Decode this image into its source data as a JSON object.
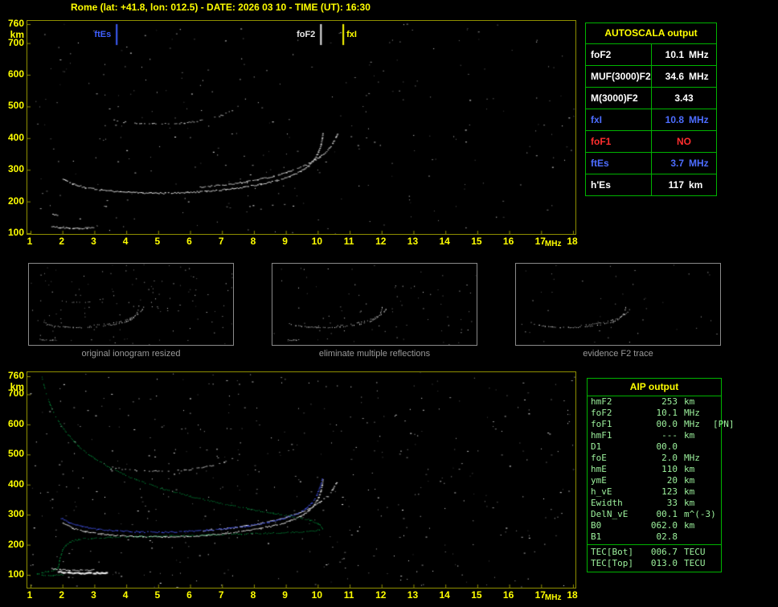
{
  "title": "Rome (lat: +41.8, lon: 012.5) - DATE: 2026 03 10 - TIME (UT): 16:30",
  "colors": {
    "background": "#000000",
    "axis_text": "#ffff00",
    "plot_frame": "#8f8f00",
    "table_border": "#00b400",
    "aip_text": "#9df29d",
    "blue": "#4d6dff",
    "red": "#ff2e2e",
    "white": "#ffffff",
    "profile_green": "#00c050",
    "caption_gray": "#9a9a9a"
  },
  "axes": {
    "x_ticks": [
      1,
      2,
      3,
      4,
      5,
      6,
      7,
      8,
      9,
      10,
      11,
      12,
      13,
      14,
      15,
      16,
      17,
      18
    ],
    "y_ticks": [
      760,
      700,
      600,
      500,
      400,
      300,
      200,
      100
    ],
    "x_unit": "MHz",
    "y_unit": "km"
  },
  "autoscala": {
    "title": "AUTOSCALA output",
    "rows": [
      {
        "label": "foF2",
        "value": "10.1",
        "unit": "MHz",
        "color": "#ffffff"
      },
      {
        "label": "MUF(3000)F2",
        "value": "34.6",
        "unit": "MHz",
        "color": "#ffffff"
      },
      {
        "label": "M(3000)F2",
        "value": "3.43",
        "unit": "",
        "color": "#ffffff"
      },
      {
        "label": "fxI",
        "value": "10.8",
        "unit": "MHz",
        "color": "#4d6dff"
      },
      {
        "label": "foF1",
        "value": "NO",
        "unit": "",
        "color": "#ff2e2e"
      },
      {
        "label": "ftEs",
        "value": "3.7",
        "unit": "MHz",
        "color": "#4d6dff"
      },
      {
        "label": "h'Es",
        "value": "117",
        "unit": "km",
        "color": "#ffffff"
      }
    ]
  },
  "aip": {
    "title": "AIP output",
    "rows": [
      {
        "label": "hmF2",
        "value": "253",
        "unit": "km",
        "extra": ""
      },
      {
        "label": "foF2",
        "value": "10.1",
        "unit": "MHz",
        "extra": ""
      },
      {
        "label": "foF1",
        "value": "00.0",
        "unit": "MHz",
        "extra": "[PN]"
      },
      {
        "label": "hmF1",
        "value": "---",
        "unit": "km",
        "extra": ""
      },
      {
        "label": "D1",
        "value": "00.0",
        "unit": "",
        "extra": ""
      },
      {
        "label": "foE",
        "value": "2.0",
        "unit": "MHz",
        "extra": ""
      },
      {
        "label": "hmE",
        "value": "110",
        "unit": "km",
        "extra": ""
      },
      {
        "label": "ymE",
        "value": "20",
        "unit": "km",
        "extra": ""
      },
      {
        "label": "h_vE",
        "value": "123",
        "unit": "km",
        "extra": ""
      },
      {
        "label": "Ewidth",
        "value": "33",
        "unit": "km",
        "extra": ""
      },
      {
        "label": "DelN_vE",
        "value": "00.1",
        "unit": "m^(-3)",
        "extra": ""
      },
      {
        "label": "B0",
        "value": "062.0",
        "unit": "km",
        "extra": ""
      },
      {
        "label": "B1",
        "value": "02.8",
        "unit": "",
        "extra": ""
      }
    ],
    "tec_rows": [
      {
        "label": "TEC[Bot]",
        "value": "006.7",
        "unit": "TECU",
        "extra": ""
      },
      {
        "label": "TEC[Top]",
        "value": "013.0",
        "unit": "TECU",
        "extra": ""
      }
    ]
  },
  "thumbnails": [
    {
      "caption": "original ionogram resized",
      "series": [
        0,
        1,
        2,
        3,
        4
      ],
      "noise": 120
    },
    {
      "caption": "eliminate multiple reflections",
      "series": [
        0,
        2,
        3
      ],
      "noise": 80
    },
    {
      "caption": "evidence F2 trace",
      "series": [
        2,
        3
      ],
      "noise": 45
    }
  ],
  "chart_data": [
    {
      "type": "scatter",
      "title": "ionogram with autoscaled characteristics",
      "xlabel": "MHz",
      "ylabel": "km",
      "xlim": [
        1,
        18
      ],
      "ylim": [
        100,
        760
      ],
      "noise_dots": 300,
      "markers": [
        {
          "label": "ftEs",
          "x": 3.7,
          "color": "#3f5fff",
          "side": "left"
        },
        {
          "label": "foF2",
          "x": 10.1,
          "color": "#e8e8e8",
          "side": "left"
        },
        {
          "label": "fxI",
          "x": 10.8,
          "color": "#ffff00",
          "side": "right"
        }
      ],
      "series": [
        {
          "name": "Es layer trace",
          "color": "#ffffff",
          "dot": 2,
          "density": 0.9,
          "points": [
            [
              1.65,
              122
            ],
            [
              1.9,
              119
            ],
            [
              2.2,
              117
            ],
            [
              2.5,
              116
            ],
            [
              2.75,
              117
            ],
            [
              2.95,
              118
            ]
          ]
        },
        {
          "name": "Es spot",
          "color": "#ffffff",
          "dot": 2,
          "density": 0.8,
          "points": [
            [
              1.68,
              162
            ],
            [
              1.82,
              158
            ]
          ]
        },
        {
          "name": "F2 trace O-mode",
          "color": "#ffffff",
          "dot": 2,
          "density": 0.92,
          "points": [
            [
              2.0,
              272
            ],
            [
              2.3,
              256
            ],
            [
              2.7,
              245
            ],
            [
              3.2,
              237
            ],
            [
              3.8,
              231
            ],
            [
              4.5,
              228
            ],
            [
              5.2,
              227
            ],
            [
              5.9,
              229
            ],
            [
              6.5,
              233
            ],
            [
              7.1,
              239
            ],
            [
              7.7,
              247
            ],
            [
              8.2,
              256
            ],
            [
              8.7,
              267
            ],
            [
              9.1,
              280
            ],
            [
              9.45,
              296
            ],
            [
              9.7,
              314
            ],
            [
              9.88,
              334
            ],
            [
              10.0,
              356
            ],
            [
              10.08,
              380
            ],
            [
              10.12,
              400
            ],
            [
              10.14,
              415
            ]
          ]
        },
        {
          "name": "F2 trace X-mode",
          "color": "#f0f0f0",
          "dot": 2,
          "density": 0.8,
          "points": [
            [
              6.3,
              246
            ],
            [
              7.0,
              253
            ],
            [
              7.6,
              261
            ],
            [
              8.1,
              270
            ],
            [
              8.6,
              281
            ],
            [
              9.0,
              293
            ],
            [
              9.4,
              307
            ],
            [
              9.75,
              323
            ],
            [
              10.05,
              342
            ],
            [
              10.3,
              363
            ],
            [
              10.45,
              385
            ],
            [
              10.55,
              403
            ],
            [
              10.6,
              415
            ]
          ]
        },
        {
          "name": "multiple reflection trace",
          "color": "#c8c8c8",
          "dot": 2,
          "density": 0.5,
          "points": [
            [
              3.55,
              458
            ],
            [
              3.9,
              452
            ],
            [
              4.3,
              448
            ],
            [
              4.8,
              446
            ],
            [
              5.3,
              446
            ],
            [
              5.8,
              449
            ],
            [
              6.3,
              456
            ],
            [
              6.7,
              465
            ],
            [
              7.05,
              476
            ],
            [
              7.3,
              488
            ]
          ]
        }
      ]
    },
    {
      "type": "scatter",
      "title": "ionogram with modeled trace and electron density profile",
      "xlabel": "MHz",
      "ylabel": "km",
      "xlim": [
        1,
        18
      ],
      "ylim": [
        100,
        760
      ],
      "noise_dots": 480,
      "markers": [],
      "series": [
        {
          "name": "Es layer trace",
          "color": "#ffffff",
          "dot": 2,
          "density": 0.9,
          "points": [
            [
              1.65,
              122
            ],
            [
              1.9,
              119
            ],
            [
              2.2,
              117
            ],
            [
              2.5,
              116
            ],
            [
              2.75,
              117
            ],
            [
              2.95,
              118
            ]
          ]
        },
        {
          "name": "Es strong echo",
          "color": "#ffffff",
          "dot": 3,
          "density": 0.95,
          "points": [
            [
              1.85,
              112
            ],
            [
              2.2,
              109
            ],
            [
              2.6,
              108
            ],
            [
              3.0,
              108
            ],
            [
              3.35,
              110
            ]
          ]
        },
        {
          "name": "F2 trace O-mode",
          "color": "#ffffff",
          "dot": 2,
          "density": 0.92,
          "points": [
            [
              2.0,
              272
            ],
            [
              2.3,
              256
            ],
            [
              2.7,
              245
            ],
            [
              3.2,
              237
            ],
            [
              3.8,
              231
            ],
            [
              4.5,
              228
            ],
            [
              5.2,
              227
            ],
            [
              5.9,
              229
            ],
            [
              6.5,
              233
            ],
            [
              7.1,
              239
            ],
            [
              7.7,
              247
            ],
            [
              8.2,
              256
            ],
            [
              8.7,
              267
            ],
            [
              9.1,
              280
            ],
            [
              9.45,
              296
            ],
            [
              9.7,
              314
            ],
            [
              9.88,
              334
            ],
            [
              10.0,
              356
            ],
            [
              10.08,
              380
            ],
            [
              10.12,
              400
            ],
            [
              10.14,
              415
            ]
          ]
        },
        {
          "name": "F2 trace X-mode",
          "color": "#f0f0f0",
          "dot": 2,
          "density": 0.8,
          "points": [
            [
              6.3,
              246
            ],
            [
              7.0,
              253
            ],
            [
              7.6,
              261
            ],
            [
              8.1,
              270
            ],
            [
              8.6,
              281
            ],
            [
              9.0,
              293
            ],
            [
              9.4,
              307
            ],
            [
              9.75,
              323
            ],
            [
              10.05,
              342
            ],
            [
              10.3,
              363
            ],
            [
              10.45,
              385
            ],
            [
              10.55,
              403
            ],
            [
              10.6,
              415
            ]
          ]
        },
        {
          "name": "multiple reflection trace",
          "color": "#c8c8c8",
          "dot": 2,
          "density": 0.4,
          "points": [
            [
              3.55,
              458
            ],
            [
              3.9,
              452
            ],
            [
              4.3,
              448
            ],
            [
              4.8,
              446
            ],
            [
              5.3,
              446
            ],
            [
              5.8,
              449
            ],
            [
              6.3,
              456
            ],
            [
              6.7,
              465
            ],
            [
              7.05,
              476
            ],
            [
              7.3,
              488
            ]
          ]
        },
        {
          "name": "modeled F2 trace",
          "color": "#4455ee",
          "dot": 2,
          "density": 0.95,
          "points": [
            [
              1.9,
              292
            ],
            [
              2.2,
              274
            ],
            [
              2.6,
              261
            ],
            [
              3.1,
              252
            ],
            [
              3.7,
              247
            ],
            [
              4.4,
              244
            ],
            [
              5.1,
              243
            ],
            [
              5.8,
              245
            ],
            [
              6.5,
              249
            ],
            [
              7.2,
              256
            ],
            [
              7.8,
              264
            ],
            [
              8.4,
              275
            ],
            [
              8.9,
              288
            ],
            [
              9.3,
              303
            ],
            [
              9.6,
              320
            ],
            [
              9.8,
              341
            ],
            [
              9.95,
              365
            ],
            [
              10.05,
              392
            ],
            [
              10.12,
              420
            ]
          ]
        },
        {
          "name": "electron density profile",
          "color": "#00c050",
          "dot": 1,
          "density": 0.85,
          "points": [
            [
              1.35,
              758
            ],
            [
              1.45,
              715
            ],
            [
              1.6,
              668
            ],
            [
              1.8,
              622
            ],
            [
              2.1,
              575
            ],
            [
              2.5,
              528
            ],
            [
              3.0,
              487
            ],
            [
              3.6,
              450
            ],
            [
              4.3,
              417
            ],
            [
              5.1,
              388
            ],
            [
              6.0,
              362
            ],
            [
              6.9,
              340
            ],
            [
              7.8,
              321
            ],
            [
              8.6,
              306
            ],
            [
              9.3,
              293
            ],
            [
              9.75,
              283
            ],
            [
              10.0,
              272
            ],
            [
              10.1,
              262
            ],
            [
              10.14,
              253
            ],
            [
              9.9,
              247
            ],
            [
              9.4,
              243
            ],
            [
              8.6,
              240
            ],
            [
              7.6,
              237
            ],
            [
              6.5,
              234
            ],
            [
              5.4,
              231
            ],
            [
              4.4,
              228
            ],
            [
              3.5,
              226
            ],
            [
              2.9,
              223
            ],
            [
              2.5,
              219
            ],
            [
              2.25,
              212
            ],
            [
              2.1,
              200
            ],
            [
              2.0,
              185
            ],
            [
              1.95,
              168
            ],
            [
              1.9,
              150
            ],
            [
              1.88,
              135
            ],
            [
              1.85,
              124
            ],
            [
              1.75,
              117
            ],
            [
              1.55,
              112
            ],
            [
              1.35,
              108
            ],
            [
              1.2,
              104
            ],
            [
              1.35,
              101
            ],
            [
              1.7,
              100
            ],
            [
              2.0,
              101
            ]
          ]
        }
      ]
    }
  ]
}
